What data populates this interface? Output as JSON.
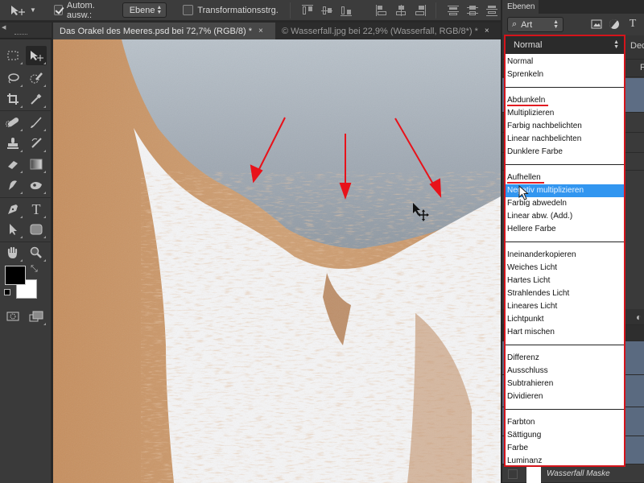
{
  "options_bar": {
    "auto_select_label": "Autom. ausw.:",
    "auto_select_checked": true,
    "auto_select_target": "Ebene",
    "transform_controls_label": "Transformationsstrg.",
    "transform_controls_checked": false,
    "align_icons": [
      "align-top-edges-icon",
      "align-vertical-centers-icon",
      "align-bottom-edges-icon",
      "align-left-edges-icon",
      "align-horizontal-centers-icon",
      "align-right-edges-icon",
      "distribute-top-icon",
      "distribute-vertical-centers-icon",
      "distribute-bottom-icon"
    ]
  },
  "doc_tabs": [
    {
      "label": "Das Orakel des Meeres.psd bei 72,7% (RGB/8) *",
      "close": "×",
      "active": true
    },
    {
      "label": "© Wasserfall.jpg bei 22,9% (Wasserfall, RGB/8*) *",
      "close": "×",
      "active": false
    }
  ],
  "toolbox": {
    "tools": [
      "rectangular-marquee",
      "move",
      "lasso",
      "quick-selection",
      "crop",
      "eyedropper",
      "spot-healing-brush",
      "brush",
      "clone-stamp",
      "history-brush",
      "eraser",
      "gradient",
      "blur",
      "dodge",
      "pen",
      "type",
      "path-selection",
      "rounded-rectangle",
      "hand",
      "zoom",
      "quick-mask",
      "screen-mode"
    ],
    "foreground_color": "#000000",
    "background_color": "#ffffff"
  },
  "layers_panel": {
    "tab_label": "Ebenen",
    "filter_label": "Art",
    "opacity_label": "Deck",
    "fill_label": "F",
    "mask_layer_name": "Wasserfall Maske"
  },
  "blend_mode": {
    "current": "Normal",
    "groups": [
      [
        "Normal",
        "Sprenkeln"
      ],
      [
        "Abdunkeln",
        "Multiplizieren",
        "Farbig nachbelichten",
        "Linear nachbelichten",
        "Dunklere Farbe"
      ],
      [
        "Aufhellen",
        "Negativ multiplizieren",
        "Farbig abwedeln",
        "Linear abw. (Add.)",
        "Hellere Farbe"
      ],
      [
        "Ineinanderkopieren",
        "Weiches Licht",
        "Hartes Licht",
        "Strahlendes Licht",
        "Lineares Licht",
        "Lichtpunkt",
        "Hart mischen"
      ],
      [
        "Differenz",
        "Ausschluss",
        "Subtrahieren",
        "Dividieren"
      ],
      [
        "Farbton",
        "Sättigung",
        "Farbe",
        "Luminanz"
      ]
    ],
    "highlighted": "Negativ multiplizieren",
    "underlined": [
      "Abdunkeln",
      "Aufhellen"
    ]
  },
  "colors": {
    "highlight_outline": "#d4141b",
    "selection": "#3296f0",
    "annotation_arrow": "#e8121a"
  }
}
